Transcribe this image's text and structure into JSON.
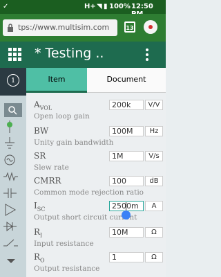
{
  "status_bar": {
    "network": "H+",
    "battery": "100%",
    "time": "12:50 PM"
  },
  "browser": {
    "url": "tps://www.multisim.com",
    "tab_count": "13"
  },
  "app": {
    "title": "* Testing .."
  },
  "tabs": {
    "item": "Item",
    "document": "Document"
  },
  "params": [
    {
      "symbol": "A",
      "sub": "VOL",
      "desc": "Open loop gain",
      "value": "200k",
      "unit": "V/V"
    },
    {
      "symbol": "BW",
      "sub": "",
      "desc": "Unity gain bandwidth",
      "value": "100M",
      "unit": "Hz"
    },
    {
      "symbol": "SR",
      "sub": "",
      "desc": "Slew rate",
      "value": "1M",
      "unit": "V/s"
    },
    {
      "symbol": "CMRR",
      "sub": "",
      "desc": "Common mode rejection ratio",
      "value": "100",
      "unit": "dB"
    },
    {
      "symbol": "I",
      "sub": "SC",
      "desc": "Output short circuit current",
      "value": "2500m",
      "unit": "A"
    },
    {
      "symbol": "R",
      "sub": "I",
      "desc": "Input resistance",
      "value": "10M",
      "unit": "Ω"
    },
    {
      "symbol": "R",
      "sub": "O",
      "desc": "Output resistance",
      "value": "1",
      "unit": "Ω"
    }
  ],
  "colors": {
    "status_bar": "#1b5e20",
    "url_bar": "#2e7d32",
    "app_bar": "#1e6b4f",
    "active_tab": "#4fbfa5"
  }
}
